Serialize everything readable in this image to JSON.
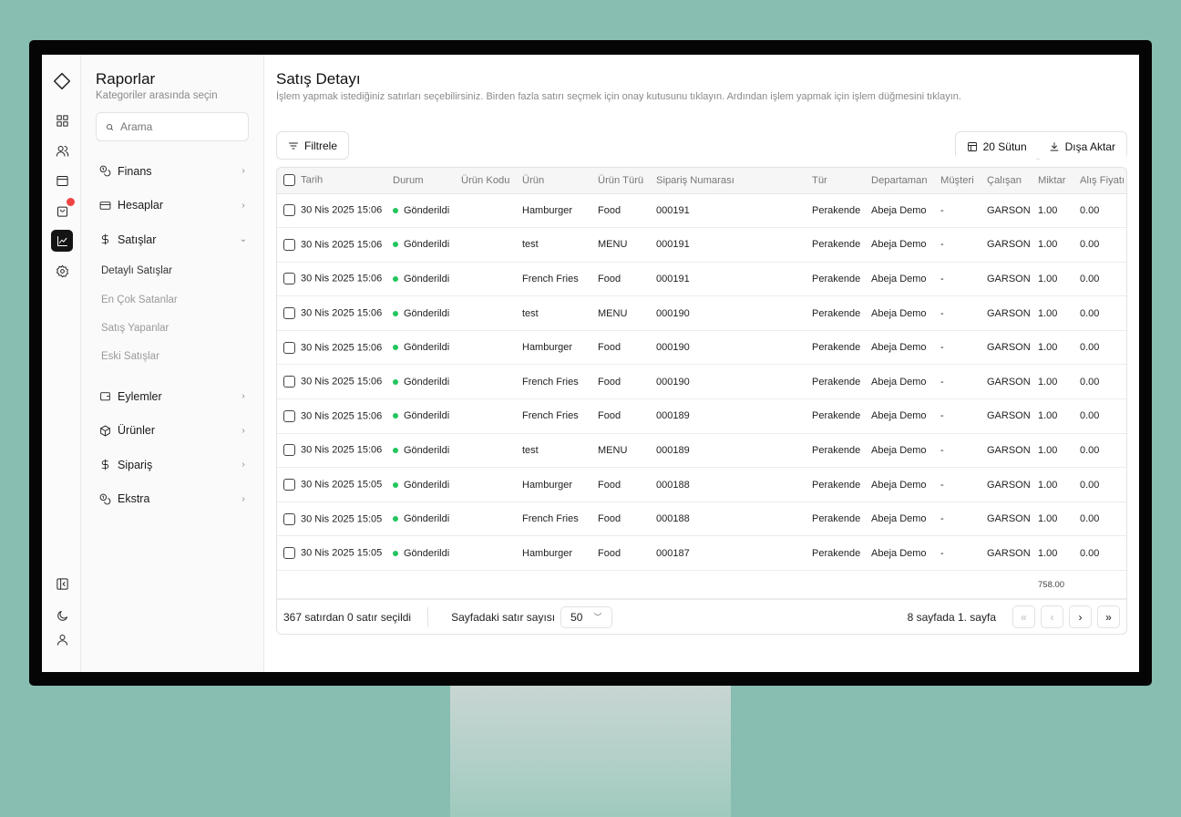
{
  "sidebar": {
    "title": "Raporlar",
    "subtitle": "Kategoriler arasında seçin",
    "search_placeholder": "Arama",
    "items": {
      "finans": "Finans",
      "hesaplar": "Hesaplar",
      "satislar": "Satışlar",
      "eylemler": "Eylemler",
      "urunler": "Ürünler",
      "siparis": "Sipariş",
      "ekstra": "Ekstra"
    },
    "satislar_sub": [
      "Detaylı Satışlar",
      "En Çok Satanlar",
      "Satış Yapanlar",
      "Eski Satışlar"
    ]
  },
  "main": {
    "title": "Satış Detayı",
    "description": "İşlem yapmak istediğiniz satırları seçebilirsiniz. Birden fazla satırı seçmek için onay kutusunu tıklayın. Ardından işlem yapmak için işlem düğmesini tıklayın.",
    "filter_label": "Filtrele",
    "columns_label": "20 Sütun",
    "export_label": "Dışa Aktar"
  },
  "table": {
    "headers": [
      "Tarih",
      "Durum",
      "Ürün Kodu",
      "Ürün",
      "Ürün Türü",
      "Sipariş Numarası",
      "Tür",
      "Departaman",
      "Müşteri",
      "Çalışan",
      "Miktar",
      "Alış Fiyatı"
    ],
    "rows": [
      [
        "30 Nis 2025 15:06",
        "Gönderildi",
        "",
        "Hamburger",
        "Food",
        "000191",
        "Perakende",
        "Abeja Demo",
        "-",
        "GARSON",
        "1.00",
        "0.00"
      ],
      [
        "30 Nis 2025 15:06",
        "Gönderildi",
        "",
        "test",
        "MENU",
        "000191",
        "Perakende",
        "Abeja Demo",
        "-",
        "GARSON",
        "1.00",
        "0.00"
      ],
      [
        "30 Nis 2025 15:06",
        "Gönderildi",
        "",
        "French Fries",
        "Food",
        "000191",
        "Perakende",
        "Abeja Demo",
        "-",
        "GARSON",
        "1.00",
        "0.00"
      ],
      [
        "30 Nis 2025 15:06",
        "Gönderildi",
        "",
        "test",
        "MENU",
        "000190",
        "Perakende",
        "Abeja Demo",
        "-",
        "GARSON",
        "1.00",
        "0.00"
      ],
      [
        "30 Nis 2025 15:06",
        "Gönderildi",
        "",
        "Hamburger",
        "Food",
        "000190",
        "Perakende",
        "Abeja Demo",
        "-",
        "GARSON",
        "1.00",
        "0.00"
      ],
      [
        "30 Nis 2025 15:06",
        "Gönderildi",
        "",
        "French Fries",
        "Food",
        "000190",
        "Perakende",
        "Abeja Demo",
        "-",
        "GARSON",
        "1.00",
        "0.00"
      ],
      [
        "30 Nis 2025 15:06",
        "Gönderildi",
        "",
        "French Fries",
        "Food",
        "000189",
        "Perakende",
        "Abeja Demo",
        "-",
        "GARSON",
        "1.00",
        "0.00"
      ],
      [
        "30 Nis 2025 15:06",
        "Gönderildi",
        "",
        "test",
        "MENU",
        "000189",
        "Perakende",
        "Abeja Demo",
        "-",
        "GARSON",
        "1.00",
        "0.00"
      ],
      [
        "30 Nis 2025 15:05",
        "Gönderildi",
        "",
        "Hamburger",
        "Food",
        "000188",
        "Perakende",
        "Abeja Demo",
        "-",
        "GARSON",
        "1.00",
        "0.00"
      ],
      [
        "30 Nis 2025 15:05",
        "Gönderildi",
        "",
        "French Fries",
        "Food",
        "000188",
        "Perakende",
        "Abeja Demo",
        "-",
        "GARSON",
        "1.00",
        "0.00"
      ],
      [
        "30 Nis 2025 15:05",
        "Gönderildi",
        "",
        "Hamburger",
        "Food",
        "000187",
        "Perakende",
        "Abeja Demo",
        "-",
        "GARSON",
        "1.00",
        "0.00"
      ]
    ],
    "total_quantity": "758.00"
  },
  "footer": {
    "selection": "367 satırdan 0 satır seçildi",
    "rows_per_page_label": "Sayfadaki satır sayısı",
    "rows_per_page_value": "50",
    "page_info": "8 sayfada 1. sayfa"
  },
  "colors": {
    "status_sent": "#22c55e",
    "notification_dot": "#ef4444",
    "active_nav": "#141414",
    "background": "#88bdb1"
  }
}
